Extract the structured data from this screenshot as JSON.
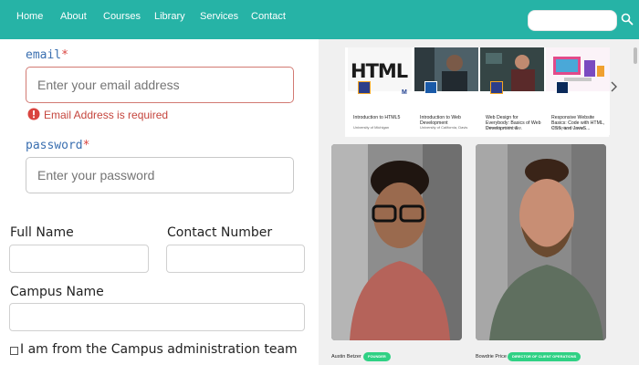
{
  "nav": {
    "links": [
      "Home",
      "About",
      "Courses",
      "Library",
      "Services",
      "Contact"
    ],
    "search_icon": "search-icon"
  },
  "form": {
    "email_label": "email",
    "email_required_mark": "*",
    "email_placeholder": "Enter your email address",
    "email_error": "Email Address is required",
    "password_label": "password",
    "password_required_mark": "*",
    "password_placeholder": "Enter your password",
    "full_name_label": "Full Name",
    "contact_number_label": "Contact Number",
    "campus_name_label": "Campus Name",
    "admin_checkbox_label": "I am from the Campus administration team"
  },
  "courses": [
    {
      "title": "Introduction to HTML5",
      "university": "University of Michigan",
      "thumb_text": "HTML"
    },
    {
      "title": "Introduction to Web Development",
      "university": "University of California, Davis",
      "thumb_text": ""
    },
    {
      "title": "Web Design for Everybody: Basics of Web Development &...",
      "university": "University of Michigan",
      "thumb_text": ""
    },
    {
      "title": "Responsive Website Basics: Code with HTML, CSS, and JavaS...",
      "university": "University of London",
      "thumb_text": ""
    }
  ],
  "people": [
    {
      "name": "Austin Betzer",
      "badge": "FOUNDER"
    },
    {
      "name": "Bowdrie Price",
      "badge": "DIRECTOR OF CLIENT OPERATIONS"
    }
  ],
  "colors": {
    "nav_bg": "#26b3a6",
    "error": "#c5453d",
    "label_blue": "#3a6fb0",
    "badge_green": "#2fd184"
  }
}
